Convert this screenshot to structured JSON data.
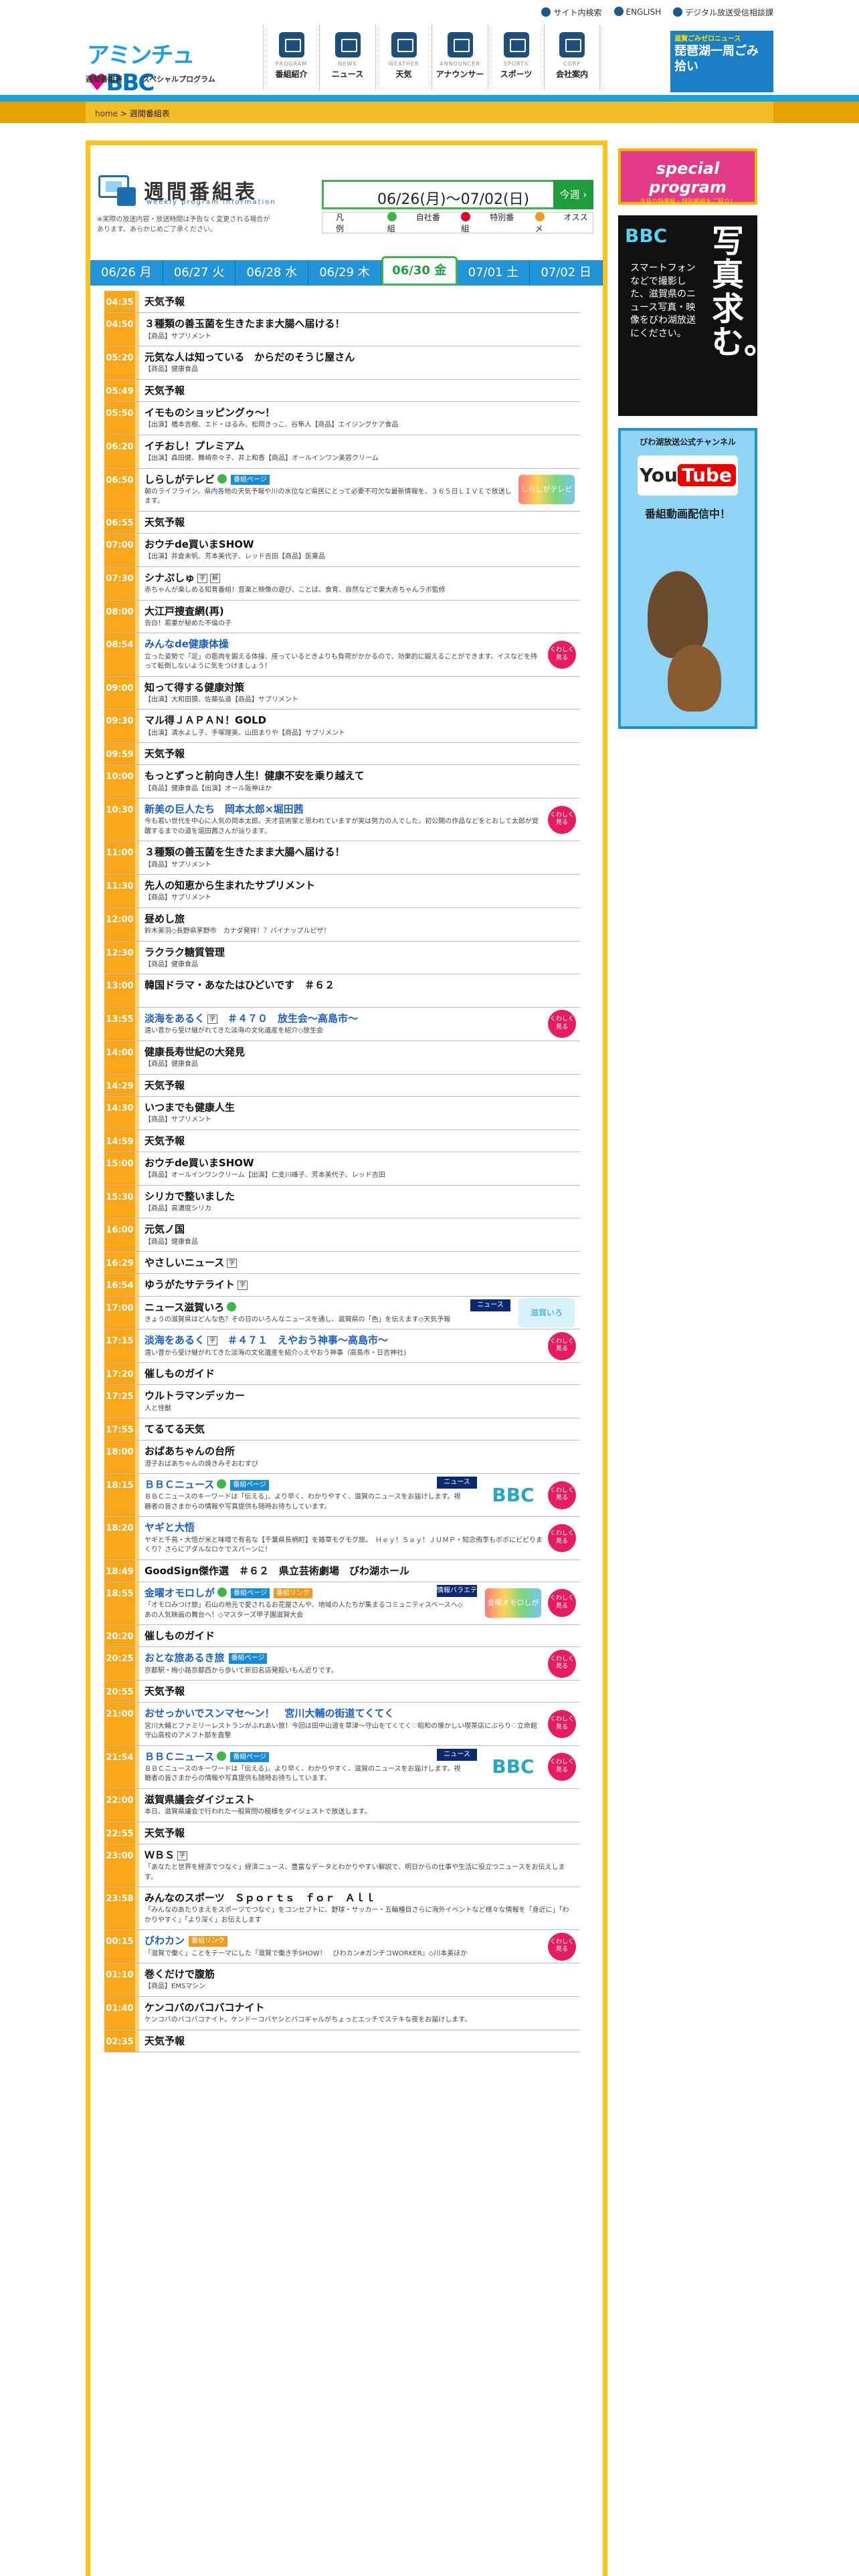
{
  "header": {
    "logo": {
      "part1": "アミンチュ",
      "part2": "BBC"
    },
    "sub_links": [
      "週間番組表",
      "スペシャルプログラム"
    ],
    "util": [
      "サイト内検索",
      "ENGLISH",
      "デジタル放送受信相談課"
    ],
    "nav": [
      {
        "en": "PROGRAM",
        "ja": "番組紹介",
        "icon": "tv-icon"
      },
      {
        "en": "NEWS",
        "ja": "ニュース",
        "icon": "news-icon"
      },
      {
        "en": "WEATHER",
        "ja": "天気",
        "icon": "cloud-icon"
      },
      {
        "en": "ANNOUNCER",
        "ja": "アナウンサー",
        "icon": "microphone-icon"
      },
      {
        "en": "SPORTS",
        "ja": "スポーツ",
        "icon": "baseball-icon"
      },
      {
        "en": "CORP",
        "ja": "会社案内",
        "icon": "building-icon"
      }
    ],
    "banner": {
      "title": "琵琶湖一周ごみ拾い",
      "small": "滋賀ごみゼロニュース"
    }
  },
  "breadcrumb": {
    "home": "home",
    "current": "週間番組表"
  },
  "page": {
    "title": "週間番組表",
    "subtitle": "weekly program information",
    "note": "※実際の放送内容・放送時間は予告なく変更される場合があります。あらかじめご了承ください。",
    "range": "06/26(月)〜07/02(日)",
    "today_label": "今週"
  },
  "legend": {
    "label": "凡例",
    "items": [
      "自社番組",
      "特別番組",
      "オススメ"
    ]
  },
  "days": [
    "06/26 月",
    "06/27 火",
    "06/28 水",
    "06/29 木",
    "06/30 金",
    "07/01 土",
    "07/02 日"
  ],
  "active_day": 4,
  "programs": [
    {
      "time": "04:35",
      "title": "天気予報"
    },
    {
      "time": "04:50",
      "title": "３種類の善玉菌を生きたまま大腸へ届ける！",
      "desc": "【商品】サプリメント"
    },
    {
      "time": "05:20",
      "title": "元気な人は知っている　からだのそうじ屋さん",
      "desc": "【商品】健康食品"
    },
    {
      "time": "05:49",
      "title": "天気予報"
    },
    {
      "time": "05:50",
      "title": "イモものショッピングゥ〜！",
      "desc": "【出演】橋本吉樹、エド・はるみ、松岡きっこ、谷隼人【商品】エイジングケア食品"
    },
    {
      "time": "06:20",
      "title": "イチおし！プレミアム",
      "desc": "【出演】森田健、舞崎奈々子、井上和香【商品】オールインワン美容クリーム"
    },
    {
      "time": "06:50",
      "title": "しらしがテレビ",
      "own": true,
      "tag": "番組ページ",
      "desc": "朝のライフライン。県内各地の天気予報や川の水位など県民にとって必要不可欠な最新情報を、３６５日ＬＩＶＥで放送します。",
      "logo": "rainbow",
      "logo_text": "しらしがテレビ"
    },
    {
      "time": "06:55",
      "title": "天気予報"
    },
    {
      "time": "07:00",
      "title": "おウチde買いまSHOW",
      "desc": "【出演】井倉未帆、芳本美代子、レッド吉田【商品】医薬品"
    },
    {
      "time": "07:30",
      "title": "シナぷしゅ",
      "marks": [
        "字",
        "解"
      ],
      "desc": "赤ちゃんが楽しめる知育番組！音楽と映像の遊び、ことば、食育、自然などで東大赤ちゃんラボ監修"
    },
    {
      "time": "08:00",
      "title": "大江戸捜査網(再)",
      "desc": "告白！若妻が秘めた不倫の子"
    },
    {
      "time": "08:54",
      "title": "みんなde健康体操",
      "blue": true,
      "desc": "立った姿勢で「足」の筋肉を鍛える体操、座っているときよりも負荷がかかるので、効果的に鍛えることができます。イスなどを持って転倒しないように気をつけましょう！",
      "osusume": true
    },
    {
      "time": "09:00",
      "title": "知って得する健康対策",
      "desc": "【出演】大和田獏、佐藤弘道【商品】サプリメント"
    },
    {
      "time": "09:30",
      "title": "マル得ＪＡＰＡＮ！GOLD",
      "desc": "【出演】清水よし子、手塚理美、山田まりや【商品】サプリメント"
    },
    {
      "time": "09:59",
      "title": "天気予報"
    },
    {
      "time": "10:00",
      "title": "もっとずっと前向き人生！健康不安を乗り越えて",
      "desc": "【商品】健康食品【出演】オール阪神ほか"
    },
    {
      "time": "10:30",
      "title": "新美の巨人たち　岡本太郎×堀田茜",
      "blue": true,
      "desc": "今も若い世代を中心に人気の岡本太郎。天才芸術家と思われていますが実は努力の人でした。初公開の作品などをとおして太郎が覚醒するまでの道を堀田茜さんが辿ります。",
      "osusume": true
    },
    {
      "time": "11:00",
      "title": "３種類の善玉菌を生きたまま大腸へ届ける！",
      "desc": "【商品】サプリメント"
    },
    {
      "time": "11:30",
      "title": "先人の知恵から生まれたサプリメント",
      "desc": "【商品】サプリメント"
    },
    {
      "time": "12:00",
      "title": "昼めし旅",
      "desc": "鈴木美羽◇長野県茅野市　カナダ発祥！？パイナップルピザ！"
    },
    {
      "time": "12:30",
      "title": "ラクラク糖質管理",
      "desc": "【商品】健康食品"
    },
    {
      "time": "13:00",
      "title": "韓国ドラマ・あなたはひどいです　＃６２",
      "desc": "　"
    },
    {
      "time": "13:55",
      "title": "淡海をあるく",
      "blue": true,
      "marks": [
        "字"
      ],
      "title2": "　＃４７０　放生会〜高島市〜",
      "desc": "遠い昔から受け継がれてきた淡海の文化遺産を紹介◇放生会",
      "osusume": true
    },
    {
      "time": "14:00",
      "title": "健康長寿世紀の大発見",
      "desc": "【商品】健康食品"
    },
    {
      "time": "14:29",
      "title": "天気予報"
    },
    {
      "time": "14:30",
      "title": "いつまでも健康人生",
      "desc": "【商品】サプリメント"
    },
    {
      "time": "14:59",
      "title": "天気予報"
    },
    {
      "time": "15:00",
      "title": "おウチde買いまSHOW",
      "desc": "【商品】オールインワンクリーム【出演】仁支川峰子、芳本美代子、レッド吉田"
    },
    {
      "time": "15:30",
      "title": "シリカで整いました",
      "desc": "【商品】高濃度シリカ"
    },
    {
      "time": "16:00",
      "title": "元気ノ国",
      "desc": "【商品】健康食品"
    },
    {
      "time": "16:29",
      "title": "やさしいニュース",
      "marks": [
        "字"
      ]
    },
    {
      "time": "16:54",
      "title": "ゆうがたサテライト",
      "marks": [
        "字"
      ]
    },
    {
      "time": "17:00",
      "title": "ニュース滋賀いろ",
      "own": true,
      "news": "ニュース",
      "desc": "きょうの滋賀県はどんな色？その日のいろんなニュースを通し、滋賀県の「色」を伝えます◇天気予報",
      "logo": "teal",
      "logo_text": "滋賀いろ"
    },
    {
      "time": "17:15",
      "title": "淡海をあるく",
      "blue": true,
      "marks": [
        "字"
      ],
      "title2": "　＃４７１　えやおう神事〜高島市〜",
      "desc": "遠い昔から受け継がれてきた淡海の文化遺産を紹介◇えやおう神事（高島市・日吉神社)",
      "osusume": true
    },
    {
      "time": "17:20",
      "title": "催しものガイド"
    },
    {
      "time": "17:25",
      "title": "ウルトラマンデッカー",
      "desc": "人と怪獣"
    },
    {
      "time": "17:55",
      "title": "てるてる天気"
    },
    {
      "time": "18:00",
      "title": "おばあちゃんの台所",
      "desc": "澄子おばあちゃんの焼きみそおむすび"
    },
    {
      "time": "18:15",
      "title": "ＢＢＣニュース",
      "blue": true,
      "own": true,
      "tag": "番組ページ",
      "news": "ニュース",
      "desc": "ＢＢＣニュースのキーワードは「伝える」。より早く、わかりやすく、滋賀のニュースをお届けします。視聴者の皆さまからの情報や写真提供も随時お待ちしています。",
      "osusume": true,
      "logo": "bbc",
      "logo_text": "BBC"
    },
    {
      "time": "18:20",
      "title": "ヤギと大悟",
      "blue": true,
      "desc": "ヤギと千鳥・大悟が米と味噌で有名な【千葉県長柄町】を雑草モグモグ旅。　Ｈｅｙ！Ｓａｙ！ＪＵＭＰ・知念侑李もボボにビビりまくり？さらにアダルなロケでスパーンに！",
      "osusume": true
    },
    {
      "time": "18:49",
      "title": "GoodSign傑作選　＃６２　県立芸術劇場　びわ湖ホール"
    },
    {
      "time": "18:55",
      "title": "金曜オモロしが",
      "blue": true,
      "own": true,
      "tag": "番組ページ",
      "tag2": "番組リンク",
      "news": "情報バラエティ",
      "desc": "「オモロみつけ旅」石山の地元で愛されるお花屋さんや、地域の人たちが集まるコミュニティスペースへ◇あの人気映画の舞台へ！◇マスターズ甲子園滋賀大会",
      "osusume": true,
      "logo": "rainbow",
      "logo_text": "金曜オモロしが"
    },
    {
      "time": "20:20",
      "title": "催しものガイド"
    },
    {
      "time": "20:25",
      "title": "おとな旅あるき旅",
      "blue": true,
      "tag": "番組ページ",
      "desc": "京都駅・梅小路京都西から歩いて新旧名店発掘いもん近りです。",
      "osusume": true
    },
    {
      "time": "20:55",
      "title": "天気予報"
    },
    {
      "time": "21:00",
      "title": "おせっかいでスンマセ〜ン！　宮川大輔の街道てくてく",
      "blue": true,
      "desc": "宮川大輔とファミリーレストランがふれあい旅！今回は田中山道を草津〜守山をてくてく♡昭和の懐かしい喫茶店にぶらり♡立命館守山高校のアメフト部を直撃",
      "osusume": true
    },
    {
      "time": "21:54",
      "title": "ＢＢＣニュース",
      "blue": true,
      "own": true,
      "tag": "番組ページ",
      "news": "ニュース",
      "desc": "ＢＢＣニュースのキーワードは「伝える」。より早く、わかりやすく、滋賀のニュースをお届けします。視聴者の皆さまからの情報や写真提供も随時お待ちしています。",
      "osusume": true,
      "logo": "bbc",
      "logo_text": "BBC"
    },
    {
      "time": "22:00",
      "title": "滋賀県議会ダイジェスト",
      "desc": "本日、滋賀県議会で行われた一般質問の模様をダイジェストで放送します。"
    },
    {
      "time": "22:55",
      "title": "天気予報"
    },
    {
      "time": "23:00",
      "title": "ＷＢＳ",
      "marks": [
        "字"
      ],
      "desc": "「あなたと世界を経済でつなぐ」経済ニュース、豊富なデータとわかりやすい解説で、明日からの仕事や生活に役立つニュースをお伝えします。"
    },
    {
      "time": "23:58",
      "title": "みんなのスポーツ　Ｓｐｏｒｔｓ　ｆｏｒ　Ａｌｌ",
      "desc": "「みんなのあたりまえをスポーツでつなぐ」をコンセプトに、野球・サッカー・五輪種目さらに海外イベントなど様々な情報を「身近に」「わかりやすく」「より深く」お伝えします"
    },
    {
      "time": "00:15",
      "title": "びわカン",
      "blue": true,
      "tag2": "番組リンク",
      "desc": "「滋賀で働く」ことをテーマにした『滋賀で働き手SHOW！　びわカン#ガンチコWORKER』◇川本美ほか",
      "osusume": true
    },
    {
      "time": "01:10",
      "title": "巻くだけで腹筋",
      "desc": "【商品】EMSマシン"
    },
    {
      "time": "01:40",
      "title": "ケンコバのバコバコナイト",
      "desc": "ケンコバのバコバコナイト。ケンドーコバヤシとバコギャルがちょっとエッチでステキな夜をお届けします。"
    },
    {
      "time": "02:35",
      "title": "天気予報"
    }
  ],
  "sidebar": {
    "special": {
      "big": "special program",
      "small": "今月の特番組・特別番組をご紹介！"
    },
    "photo": {
      "brand": "BBC",
      "big": "写真求む。",
      "text": "スマートフォンなどで撮影した、滋賀県のニュース写真・映像をびわ湖放送にください。"
    },
    "youtube": {
      "caption": "びわ湖放送公式チャンネル",
      "logo_a": "You",
      "logo_b": "Tube",
      "caption2": "番組動画配信中！"
    }
  }
}
